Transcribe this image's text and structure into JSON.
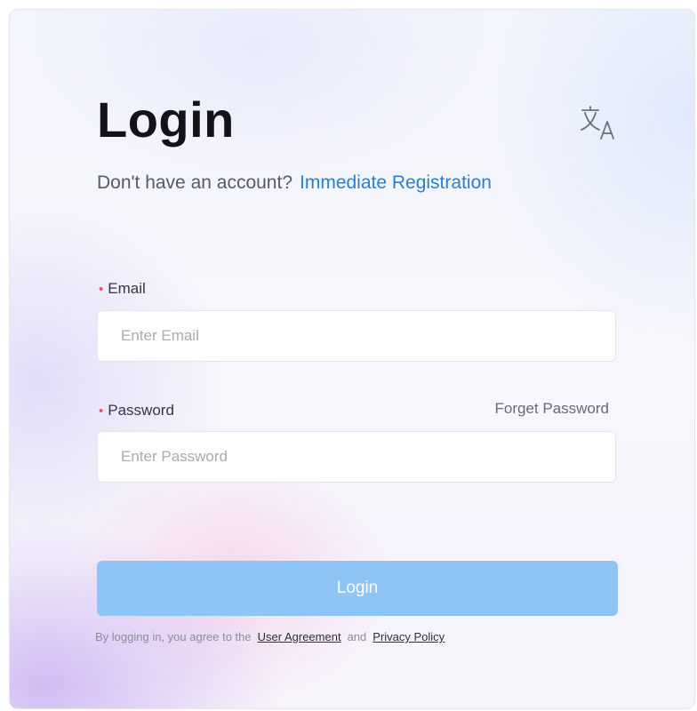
{
  "login": {
    "title": "Login",
    "register_prompt": "Don't have an account?",
    "register_link": "Immediate Registration",
    "email": {
      "label": "Email",
      "required_marker": "•",
      "placeholder": "Enter Email",
      "value": ""
    },
    "password": {
      "label": "Password",
      "required_marker": "•",
      "placeholder": "Enter Password",
      "value": ""
    },
    "forget_password": "Forget Password",
    "submit_label": "Login",
    "agreement": {
      "prefix": "By logging in, you agree to the",
      "user_agreement": "User Agreement",
      "conjunction": "and",
      "privacy_policy": "Privacy Policy"
    },
    "icons": {
      "language": "translate-icon"
    },
    "colors": {
      "link": "#2680d0",
      "button": "#8ec5f5",
      "required": "#f0506e"
    }
  }
}
